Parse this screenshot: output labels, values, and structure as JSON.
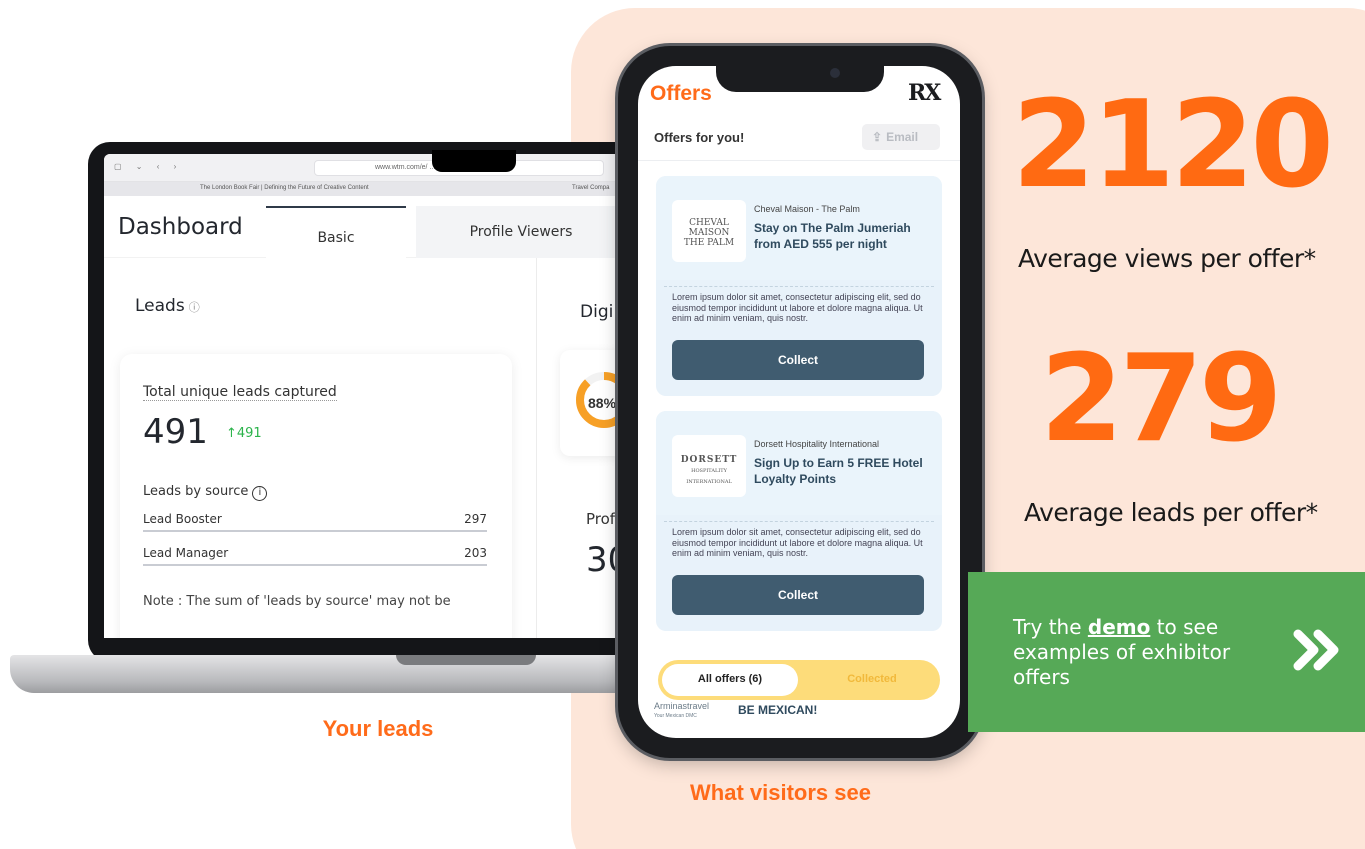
{
  "laptop": {
    "browser": {
      "nav": "▢ ⌄ ‹ ›",
      "url": "www.wtm.com/e/ ... .html#/",
      "tab1": "The London Book Fair | Defining the Future of Creative Content",
      "tab2": "Travel Compa"
    },
    "dashboard": {
      "title": "Dashboard",
      "tabs": [
        "Basic",
        "Profile Viewers"
      ],
      "leads_heading": "Leads",
      "info_glyph": "ⓘ",
      "digital_heading": "Digi",
      "total_label": "Total unique leads captured",
      "total_value": "491",
      "total_change": "↑491",
      "by_source_label": "Leads by source",
      "sources": [
        {
          "name": "Lead Booster",
          "value": "297"
        },
        {
          "name": "Lead Manager",
          "value": "203"
        }
      ],
      "note": "Note : The sum of 'leads by source' may not be",
      "donut_value": "88%",
      "donut_percent": 88,
      "profile_label": "Prof",
      "profile_value": "30"
    },
    "caption": "Your leads"
  },
  "phone": {
    "header_title": "Offers",
    "brand": "RX",
    "subheading": "Offers for you!",
    "email_button": "Email",
    "offers": [
      {
        "logo_lines": [
          "CHEVAL",
          "MAISON",
          "THE PALM"
        ],
        "company": "Cheval Maison - The Palm",
        "headline": "Stay on The Palm Jumeriah from AED 555 per night",
        "body": "Lorem ipsum dolor sit amet, consectetur adipiscing elit, sed do eiusmod tempor incididunt ut labore et dolore magna aliqua. Ut enim ad minim veniam, quis nostr.",
        "button": "Collect"
      },
      {
        "logo_lines": [
          "DORSETT",
          "HOSPITALITY",
          "INTERNATIONAL"
        ],
        "company": "Dorsett Hospitality International",
        "headline": "Sign Up to Earn 5 FREE Hotel Loyalty Points",
        "body": "Lorem ipsum dolor sit amet, consectetur adipiscing elit, sed do eiusmod tempor incididunt ut labore et dolore magna aliqua. Ut enim ad minim veniam, quis nostr.",
        "button": "Collect"
      }
    ],
    "segment": {
      "all": "All offers (6)",
      "collected": "Collected"
    },
    "peek": {
      "logo": "Arminastravel",
      "logo_sub": "Your Mexican DMC",
      "text": "BE MEXICAN!"
    },
    "caption": "What visitors see"
  },
  "stats": [
    {
      "value": "2120",
      "label": "Average views per offer*"
    },
    {
      "value": "279",
      "label": "Average leads per offer*"
    }
  ],
  "demo": {
    "prefix": "Try the ",
    "link": "demo",
    "suffix": " to see examples of exhibitor offers"
  },
  "colors": {
    "accent_orange": "#ff6a12",
    "peach_bg": "#fde6d9",
    "demo_green": "#56a957",
    "collect_btn": "#405c70"
  }
}
